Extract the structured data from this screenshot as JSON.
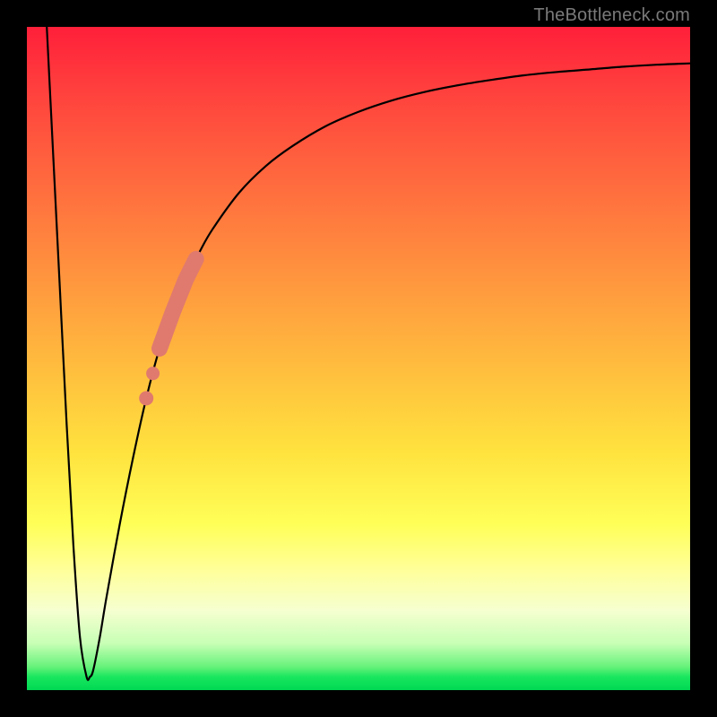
{
  "attribution": "TheBottleneck.com",
  "colors": {
    "overlay": "#e07a6e",
    "curve": "#000000"
  },
  "chart_data": {
    "type": "line",
    "title": "",
    "xlabel": "",
    "ylabel": "",
    "xlim": [
      0,
      100
    ],
    "ylim": [
      0,
      100
    ],
    "grid": false,
    "series": [
      {
        "name": "bottleneck-curve",
        "x": [
          3,
          4,
          5,
          6,
          7,
          8,
          9,
          9.5,
          10,
          11,
          12,
          14,
          16,
          18,
          20,
          22,
          24,
          26,
          28,
          32,
          36,
          40,
          45,
          50,
          55,
          60,
          65,
          70,
          75,
          80,
          85,
          90,
          95,
          100
        ],
        "values": [
          100,
          80,
          60,
          40,
          22,
          8,
          2,
          2,
          3,
          8,
          14,
          25,
          35,
          44,
          51.5,
          57,
          62,
          66,
          69.5,
          75,
          79,
          82,
          85,
          87.2,
          88.9,
          90.2,
          91.2,
          92,
          92.7,
          93.2,
          93.6,
          94,
          94.3,
          94.5
        ]
      }
    ],
    "annotations": {
      "highlight_segment": {
        "x_start": 20,
        "x_end": 25.5
      },
      "highlight_dots_x": [
        18,
        19,
        20
      ]
    }
  }
}
